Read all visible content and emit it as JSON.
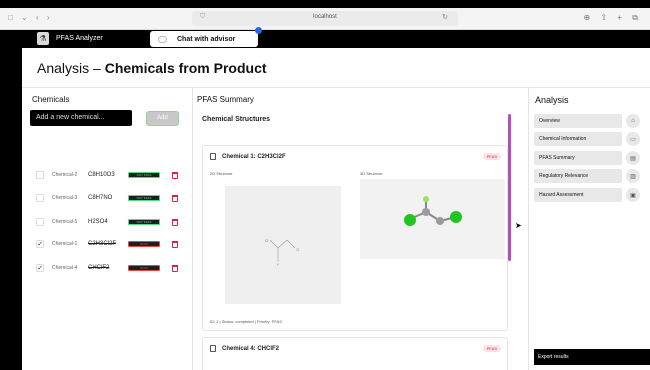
{
  "browser": {
    "nav_symbols": "□ ⌄ ‹ ›",
    "host": "localhost",
    "tools_symbols": "⊕ ⇧ + ⧉"
  },
  "appbar": {
    "brand": "PFAS Analyzer",
    "chat_label": "Chat with advisor"
  },
  "page": {
    "title_prefix": "Analysis – ",
    "title_bold": "Chemicals from Product"
  },
  "chemicals": {
    "heading": "Chemicals",
    "input_placeholder": "Add a new chemical...",
    "add_label": "Add",
    "items": [
      {
        "name": "Chemical-2",
        "formula": "C8H10O3",
        "checked": false,
        "tag": "NOT PFAS"
      },
      {
        "name": "Chemical-3",
        "formula": "C8H7NO",
        "checked": false,
        "tag": "NOT PFAS"
      },
      {
        "name": "Chemical-5",
        "formula": "H2SO4",
        "checked": false,
        "tag": "NOT PFAS"
      },
      {
        "name": "Chemical-1",
        "formula": "C2H3Cl2F",
        "checked": true,
        "tag": "PFAS"
      },
      {
        "name": "Chemical-4",
        "formula": "CHClF2",
        "checked": true,
        "tag": "PFAS"
      }
    ]
  },
  "pfas_summary": {
    "heading": "PFAS Summary",
    "subheading": "Chemical Structures",
    "cards": [
      {
        "title": "Chemical 1: C2H3Cl2F",
        "badge": "PFAS",
        "label_2d": "2D Structure",
        "label_3d": "3D Structure",
        "footer": "ID: 1 | Status: completed | Priority: PFAS"
      },
      {
        "title": "Chemical 4: CHClF2",
        "badge": "PFAS"
      }
    ]
  },
  "analysis": {
    "heading": "Analysis",
    "items": [
      {
        "label": "Overview",
        "icon": "home-icon",
        "glyph": "⌂"
      },
      {
        "label": "Chemical Information",
        "icon": "book-icon",
        "glyph": "▭"
      },
      {
        "label": "PFAS Summary",
        "icon": "clipboard-icon",
        "glyph": "▤"
      },
      {
        "label": "Regulatory Relevance",
        "icon": "document-icon",
        "glyph": "▥"
      },
      {
        "label": "Hazard Assessment",
        "icon": "clipboard-check-icon",
        "glyph": "▣"
      }
    ],
    "export_label": "Export results"
  },
  "colors": {
    "not_pfas_tag": "#4ade80",
    "pfas_tag": "#ef4444",
    "accent_scrollbar": "#b54dbd",
    "chat_dot": "#2563eb"
  }
}
